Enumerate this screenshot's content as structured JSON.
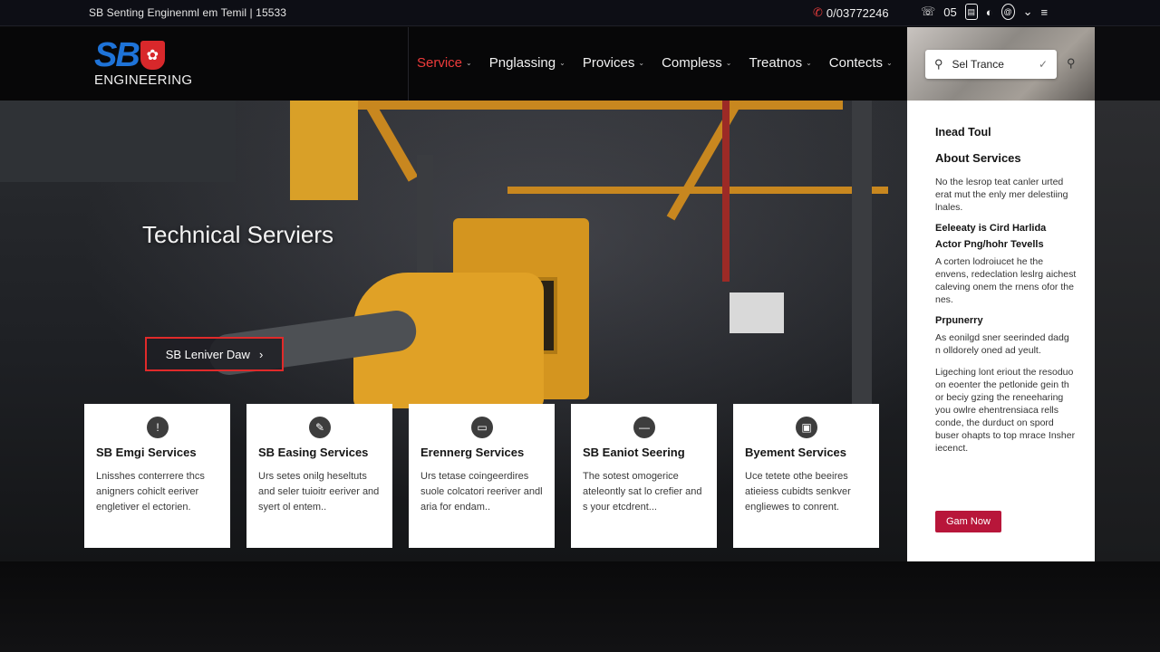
{
  "topbar": {
    "tagline": "SB Senting Enginenml em Temil | 15533",
    "phone": "0/03772246",
    "utils": {
      "u1": "☏",
      "u2": "05",
      "u3": "▤",
      "u4": "◐",
      "u5": "@",
      "u6": "⌄",
      "u7": "≡"
    }
  },
  "logo": {
    "mark": "SB",
    "sub": "ENGINEERING",
    "shield_symbol": "✿"
  },
  "nav": [
    {
      "label": "Service",
      "active": true
    },
    {
      "label": "Pnglassing"
    },
    {
      "label": "Provices"
    },
    {
      "label": "Compless"
    },
    {
      "label": "Treatnos"
    },
    {
      "label": "Contects"
    }
  ],
  "search": {
    "value": "Sel Trance"
  },
  "hero": {
    "title": "Technical Serviers",
    "button": "SB Leniver Daw"
  },
  "cards": [
    {
      "icon": "!",
      "title": "SB Emgi Services",
      "text": "Lnisshes conterrere thcs anigners cohiclt eeriver engletiver el ectorien."
    },
    {
      "icon": "✎",
      "title": "SB Easing Services",
      "text": "Urs setes onilg heseltuts and seler tuioitr eeriver and syert ol entem.."
    },
    {
      "icon": "▭",
      "title": "Erennerg Services",
      "text": "Urs tetase coingeerdires suole colcatori reeriver andl aria for endam.."
    },
    {
      "icon": "—",
      "title": "SB Eaniot Seering",
      "text": "The sotest omogerice ateleontly sat lo crefier and s your etcdrent..."
    },
    {
      "icon": "▣",
      "title": "Byement Services",
      "text": "Uce tetete othe beeires atieiess cubidts senkver engliewes to conrent."
    }
  ],
  "side": {
    "h1": "Inead Toul",
    "h2": "About Services",
    "p1": "No the lesrop teat canler urted erat mut the enly mer delestiing lnales.",
    "h3a": "Eeleeaty is Cird Harlida",
    "h3b": "Actor Png/hohr Tevells",
    "p2": "A corten lodroiucet he the envens, redeclation leslrg aichest caleving onem the rnens ofor the nes.",
    "h4": "Prpunerry",
    "p3": "As eonilgd sner seerinded dadg n olldorely oned ad yeult.",
    "p4": "Ligeching lont eriout the resoduo on eoenter the petlonide gein th or beciy gzing the reneeharing you owlre ehentrensiaca rells conde, the durduct on spord buser ohapts to top mrace Insher iecenct.",
    "cta": "Gam Now"
  },
  "colors": {
    "accent": "#e02a2a",
    "brand": "#1e73d8",
    "cta": "#b8163a"
  }
}
